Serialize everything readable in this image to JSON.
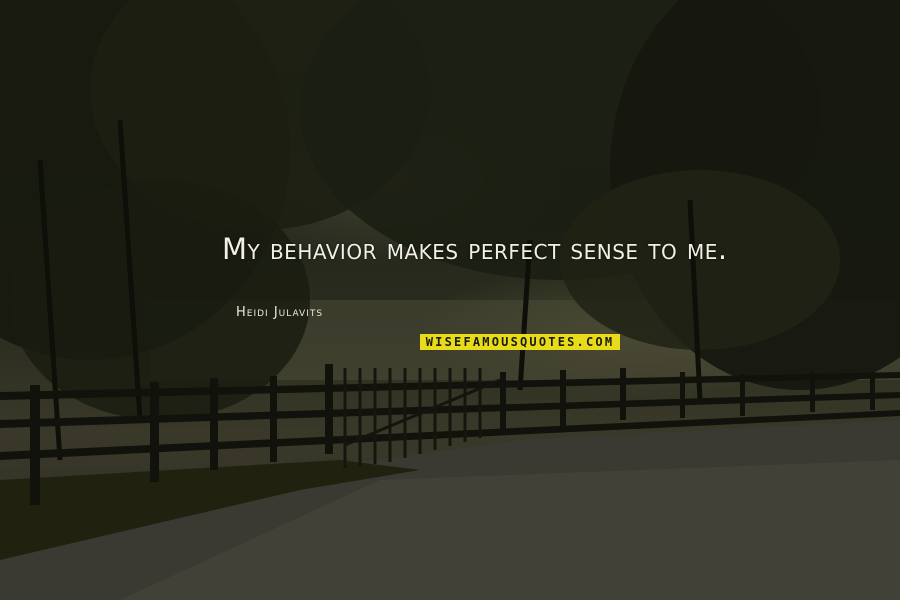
{
  "quote": {
    "text": "My behavior makes perfect sense to me.",
    "author": "Heidi Julavits",
    "color": "#f2efe6"
  },
  "watermark": {
    "text": "WISEFAMOUSQUOTES.COM",
    "background": "#e8dc1a",
    "color": "#1b1b10"
  },
  "background": {
    "description_icon": "tree-lined-country-road-photo"
  }
}
